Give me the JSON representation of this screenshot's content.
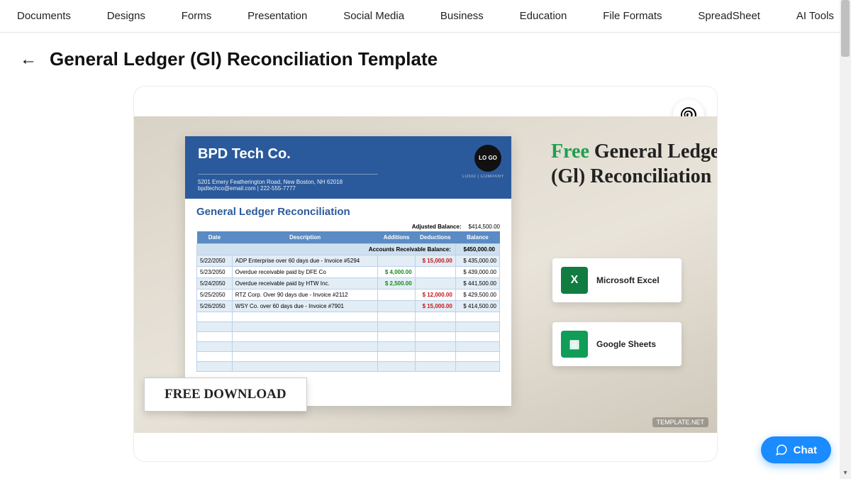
{
  "nav": [
    "Documents",
    "Designs",
    "Forms",
    "Presentation",
    "Social Media",
    "Business",
    "Education",
    "File Formats",
    "SpreadSheet",
    "AI Tools"
  ],
  "page_title": "General Ledger (Gl) Reconciliation Template",
  "preview": {
    "company": "BPD Tech Co.",
    "address_line1": "5201 Emery Featherington Road, New Boston, NH 62018",
    "address_line2": "bpdtechco@email.com | 222-555-7777",
    "logo_text": "LO\nGO",
    "logo_sub": "LOGO | COMPANY",
    "doc_title": "General Ledger Reconciliation",
    "adjusted_label": "Adjusted Balance:",
    "adjusted_value": "$414,500.00",
    "ar_label": "Accounts Receivable Balance:",
    "ar_value": "$450,000.00",
    "columns": [
      "Date",
      "Description",
      "Additions",
      "Deductions",
      "Balance"
    ],
    "rows": [
      {
        "date": "5/22/2050",
        "desc": "ADP Enterprise over 60 days due - Invoice #5294",
        "add": "",
        "ded": "15,000.00",
        "bal": "435,000.00"
      },
      {
        "date": "5/23/2050",
        "desc": "Overdue receivable paid by DFE Co",
        "add": "4,000.00",
        "ded": "",
        "bal": "439,000.00"
      },
      {
        "date": "5/24/2050",
        "desc": "Overdue receivable paid by HTW Inc.",
        "add": "2,500.00",
        "ded": "",
        "bal": "441,500.00"
      },
      {
        "date": "5/25/2050",
        "desc": "RTZ Corp. Over 90 days due - Invoice #2112",
        "add": "",
        "ded": "12,000.00",
        "bal": "429,500.00"
      },
      {
        "date": "5/26/2050",
        "desc": "WSY Co. over 60 days due - Invoice #7901",
        "add": "",
        "ded": "15,000.00",
        "bal": "414,500.00"
      }
    ],
    "overlay_free": "Free",
    "overlay_rest": " General Ledger (Gl) Reconciliation",
    "download": "FREE DOWNLOAD",
    "watermark": "TEMPLATE.NET",
    "files": [
      {
        "icon": "X",
        "label": "Microsoft Excel"
      },
      {
        "icon": "▦",
        "label": "Google Sheets"
      }
    ]
  },
  "chat": "Chat"
}
